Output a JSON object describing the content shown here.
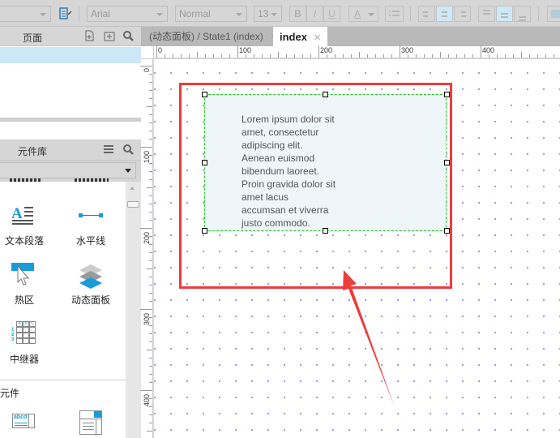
{
  "toolbar": {
    "style_select": "",
    "font_family": "Arial",
    "font_weight": "Normal",
    "font_size": "13",
    "bold_label": "B",
    "italic_label": "I",
    "underline_label": "U",
    "font_color_label": "A",
    "align_h_active": "center",
    "align_v_active": "middle"
  },
  "pages_panel": {
    "title": "页面",
    "selected_row": ""
  },
  "library_panel": {
    "title": "元件库",
    "dropdown_value": "",
    "widgets": [
      {
        "label": "文本段落",
        "icon": "text-paragraph-icon"
      },
      {
        "label": "水平线",
        "icon": "horizontal-line-icon"
      },
      {
        "label": "热区",
        "icon": "hotspot-icon"
      },
      {
        "label": "动态面板",
        "icon": "dynamic-panel-icon"
      },
      {
        "label": "中继器",
        "icon": "repeater-icon"
      }
    ],
    "section2_title": "元件",
    "repeater_headers": [
      "A",
      "B",
      "C"
    ],
    "repeater_rows": [
      "1",
      "2",
      "3"
    ],
    "textfield_icon_text": "abcd"
  },
  "tabs": [
    {
      "label": "(动态面板) / State1 (index)",
      "active": false
    },
    {
      "label": "index",
      "active": true
    }
  ],
  "ruler": {
    "top_labels": [
      "0",
      "100",
      "200",
      "300",
      "400"
    ],
    "left_labels": [
      "0",
      "100",
      "200",
      "300",
      "400"
    ]
  },
  "canvas": {
    "text_lines": [
      "Lorem ipsum dolor sit",
      "amet, consectetur",
      "adipiscing elit.",
      "Aenean euismod",
      "bibendum laoreet.",
      "Proin gravida dolor sit",
      "amet lacus",
      "accumsan et viverra",
      "justo commodo."
    ],
    "highlight_color": "#ee3b3b",
    "selection_color": "#22cc22",
    "panel_fill": "#eef6f9"
  },
  "colors": {
    "accent": "#1a9bd7",
    "selected_row": "#cce8f6"
  }
}
